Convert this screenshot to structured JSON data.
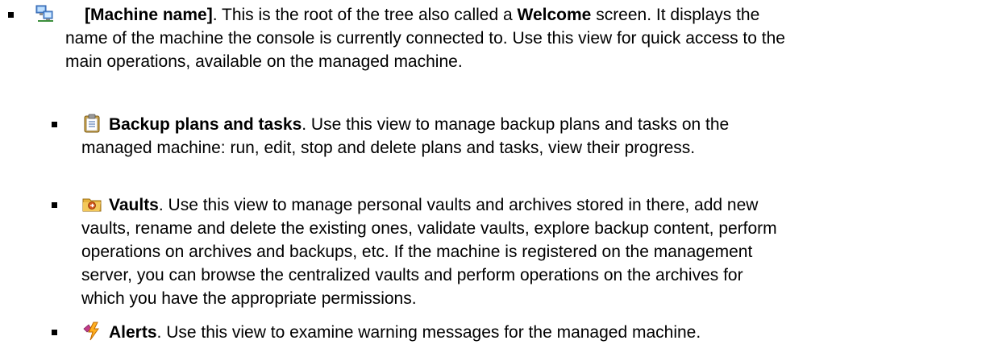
{
  "items": [
    {
      "icon": "computer-network-icon",
      "term": "[Machine name]",
      "lines": [
        ". This is the root of the tree also called a ",
        "name of the machine the console is currently connected to. Use this view for quick access to the",
        "main operations, available on the managed machine."
      ],
      "strong": "Welcome",
      "line1_tail": " screen. It displays the"
    },
    {
      "icon": "clipboard-icon",
      "term": "Backup plans and tasks",
      "lines": [
        ". Use this view to manage backup plans and tasks on the",
        "managed machine: run, edit, stop and delete plans and tasks, view their progress."
      ]
    },
    {
      "icon": "vault-folder-icon",
      "term": "Vaults",
      "lines": [
        ". Use this view to manage personal vaults and archives stored in there, add new",
        "vaults, rename and delete the existing ones, validate vaults, explore backup content, perform",
        "operations on archives and backups, etc. If the machine is registered on the management",
        "server, you can browse the centralized vaults and perform operations on the archives for",
        "which you have the appropriate permissions."
      ]
    },
    {
      "icon": "alert-lightning-icon",
      "term": "Alerts",
      "lines": [
        ". Use this view to examine warning messages for the managed machine."
      ]
    }
  ]
}
